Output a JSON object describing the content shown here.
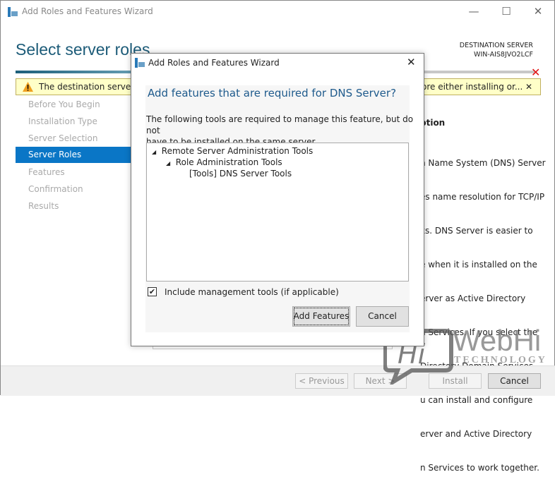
{
  "window": {
    "title": "Add Roles and Features Wizard",
    "minimize": "—",
    "maximize": "☐",
    "close": "✕"
  },
  "page": {
    "title": "Select server roles",
    "destination_label": "DESTINATION SERVER",
    "destination_server": "WIN-AIS8JVO2LCF"
  },
  "banner": {
    "text_left": "The destination server ha",
    "text_right": "ore either installing or...",
    "close": "✕",
    "icon": "warning-icon"
  },
  "sidebar": {
    "items": [
      {
        "label": "Before You Begin"
      },
      {
        "label": "Installation Type"
      },
      {
        "label": "Server Selection"
      },
      {
        "label": "Server Roles",
        "selected": true
      },
      {
        "label": "Features"
      },
      {
        "label": "Confirmation"
      },
      {
        "label": "Results"
      }
    ]
  },
  "description": {
    "heading": "ption",
    "lines": [
      "n Name System (DNS) Server",
      "es name resolution for TCP/IP",
      "ks. DNS Server is easier to",
      "e when it is installed on the",
      "erver as Active Directory",
      "n Services. If you select the",
      "Directory Domain Services",
      "u can install and configure",
      "erver and Active Directory",
      "n Services to work together."
    ]
  },
  "footer": {
    "previous": "< Previous",
    "next": "Next >",
    "install": "Install",
    "cancel": "Cancel"
  },
  "dialog": {
    "title": "Add Roles and Features Wizard",
    "close": "✕",
    "heading": "Add features that are required for DNS Server?",
    "message_line1": "The following tools are required to manage this feature, but do not",
    "message_line2": "have to be installed on the same server.",
    "tree": [
      {
        "label": "Remote Server Administration Tools",
        "level": 0,
        "expanded": true
      },
      {
        "label": "Role Administration Tools",
        "level": 1,
        "expanded": true
      },
      {
        "label": "[Tools] DNS Server Tools",
        "level": 2
      }
    ],
    "checkbox_label": "Include management tools (if applicable)",
    "checkbox_checked": true,
    "add_features": "Add Features",
    "cancel": "Cancel"
  },
  "watermark": {
    "logo_text": "Hi",
    "brand": "WebHi",
    "tagline": "TECHNOLOGY"
  },
  "colors": {
    "accent": "#0a76c6",
    "title": "#1c5b78",
    "heading": "#1e5a8c",
    "error": "#e01010",
    "banner": "#ffffc8"
  }
}
